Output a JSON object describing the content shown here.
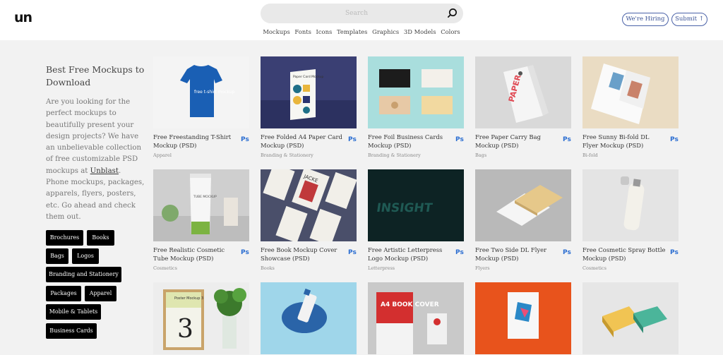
{
  "header": {
    "logo": "un",
    "search_placeholder": "Search",
    "nav": [
      "Mockups",
      "Fonts",
      "Icons",
      "Templates",
      "Graphics",
      "3D Models",
      "Colors"
    ],
    "hiring_label": "We're Hiring",
    "submit_label": "Submit ↑"
  },
  "sidebar": {
    "title": "Best Free Mockups to Download",
    "desc_before": "Are you looking for the perfect mockups to beautifully present your design projects? We have an unbelievable collection of free customizable PSD mockups at ",
    "desc_link": "Unblast",
    "desc_after": ". Phone mockups, packages, apparels, flyers, posters, etc. Go ahead and check them out.",
    "tags": [
      "Brochures",
      "Books",
      "Bags",
      "Logos",
      "Branding and Stationery",
      "Packages",
      "Apparel",
      "Mobile & Tablets",
      "Business Cards"
    ]
  },
  "cards": [
    {
      "title": "Free Freestanding T-Shirt Mockup (PSD)",
      "category": "Apparel",
      "badge": "Ps",
      "thumb_text": "free t-shirt mockup"
    },
    {
      "title": "Free Folded A4 Paper Card Mockup (PSD)",
      "category": "Branding & Stationery",
      "badge": "Ps",
      "thumb_text": "Paper Card Mockup"
    },
    {
      "title": "Free Foil Business Cards Mockup (PSD)",
      "category": "Branding & Stationery",
      "badge": "Ps",
      "thumb_text": ""
    },
    {
      "title": "Free Paper Carry Bag Mockup (PSD)",
      "category": "Bags",
      "badge": "Ps",
      "thumb_text": "PAPER"
    },
    {
      "title": "Free Sunny Bi-fold DL Flyer Mockup (PSD)",
      "category": "Bi-fold",
      "badge": "Ps",
      "thumb_text": ""
    },
    {
      "title": "Free Realistic Cosmetic Tube Mockup (PSD)",
      "category": "Cosmetics",
      "badge": "Ps",
      "thumb_text": "TUBE MOCKUP"
    },
    {
      "title": "Free Book Mockup Cover Showcase (PSD)",
      "category": "Books",
      "badge": "Ps",
      "thumb_text": "JACKE"
    },
    {
      "title": "Free Artistic Letterpress Logo Mockup (PSD)",
      "category": "Letterpress",
      "badge": "Ps",
      "thumb_text": "INSIGHT"
    },
    {
      "title": "Free Two Side DL Flyer Mockup (PSD)",
      "category": "Flyers",
      "badge": "Ps",
      "thumb_text": ""
    },
    {
      "title": "Free Cosmetic Spray Bottle Mockup (PSD)",
      "category": "Cosmetics",
      "badge": "Ps",
      "thumb_text": ""
    },
    {
      "title": "",
      "category": "",
      "badge": "",
      "thumb_text": "Poster Mockup 3"
    },
    {
      "title": "",
      "category": "",
      "badge": "",
      "thumb_text": ""
    },
    {
      "title": "",
      "category": "",
      "badge": "",
      "thumb_text": "A4 BOOK COVER"
    },
    {
      "title": "",
      "category": "",
      "badge": "",
      "thumb_text": ""
    },
    {
      "title": "",
      "category": "",
      "badge": "",
      "thumb_text": ""
    }
  ]
}
